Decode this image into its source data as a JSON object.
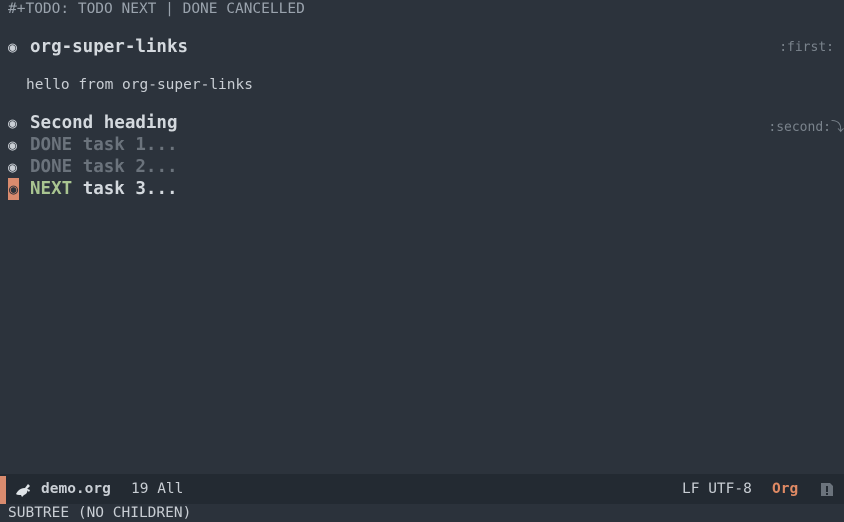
{
  "buffer": {
    "todo_keywords_line": "#+TODO: TODO NEXT | DONE CANCELLED",
    "bullet_glyph": "◉",
    "headings": [
      {
        "title": "org-super-links",
        "tag": ":first:"
      },
      {
        "title": "Second heading",
        "tag": ":second:⤵"
      },
      {
        "keyword": "DONE",
        "title": "task 1..."
      },
      {
        "keyword": "DONE",
        "title": "task 2..."
      },
      {
        "keyword": "NEXT",
        "title": "task 3..."
      }
    ],
    "body_text": "hello from org-super-links"
  },
  "modeline": {
    "file_name": "demo.org",
    "position": "19 All",
    "encoding": "LF UTF-8",
    "major_mode": "Org",
    "icon": "emacs-gnu-icon",
    "accent_color": "#d98b6e"
  },
  "echo_area": {
    "message": "SUBTREE (NO CHILDREN)"
  },
  "colors": {
    "background": "#2c333c",
    "next_keyword": "#a9c591",
    "done": "#6b737c",
    "mode": "#e08a64"
  }
}
